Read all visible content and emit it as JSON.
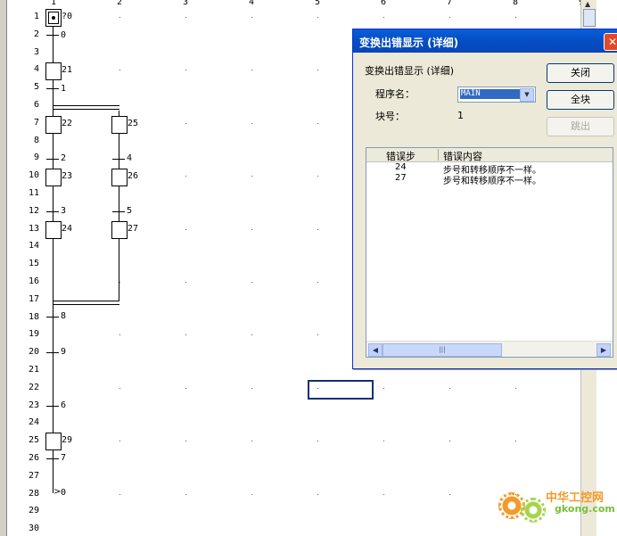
{
  "editor": {
    "column_numbers": [
      "1",
      "2",
      "3",
      "4",
      "5",
      "6",
      "7",
      "8",
      "9"
    ],
    "row_numbers": [
      "1",
      "2",
      "3",
      "4",
      "5",
      "6",
      "7",
      "8",
      "9",
      "10",
      "11",
      "12",
      "13",
      "14",
      "15",
      "16",
      "17",
      "18",
      "19",
      "20",
      "21",
      "22",
      "23",
      "24",
      "25",
      "26",
      "27",
      "28",
      "29",
      "30"
    ],
    "sfc_labels": {
      "init_step": "?0",
      "t0": "0",
      "s21": "21",
      "t1": "1",
      "s22": "22",
      "s25": "25",
      "t2": "2",
      "t4": "4",
      "s23": "23",
      "s26": "26",
      "t3": "3",
      "t5": "5",
      "s24": "24",
      "s27": "27",
      "t8": "8",
      "t9": "9",
      "t6": "6",
      "s29": "29",
      "t7": "7",
      "jump0": "0"
    }
  },
  "dialog": {
    "title": "变换出错显示 (详细)",
    "heading": "变换出错显示 (详细)",
    "program_label": "程序名：",
    "program_value": "MAIN",
    "block_label": "块号：",
    "block_value": "1",
    "buttons": {
      "close": "关闭",
      "all_blocks": "全块",
      "jump": "跳出"
    },
    "columns": [
      "错误步",
      "错误内容"
    ],
    "rows": [
      {
        "step": "24",
        "content": "步号和转移顺序不一样。"
      },
      {
        "step": "27",
        "content": "步号和转移顺序不一样。"
      }
    ]
  },
  "watermark": {
    "text_cn": "中华工控网",
    "text_en": "gkong.com"
  }
}
